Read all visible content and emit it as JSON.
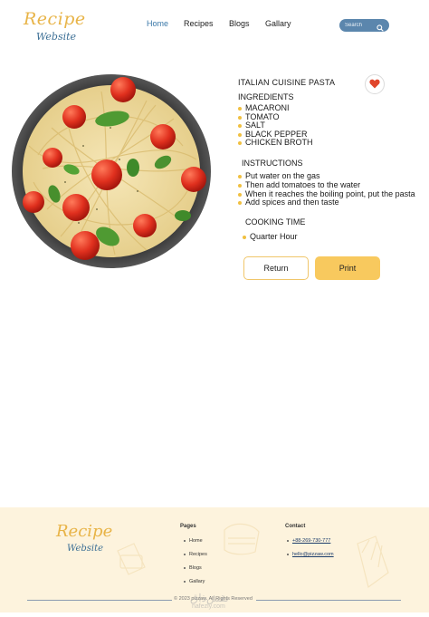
{
  "header": {
    "logo_line1": "Recipe",
    "logo_line2": "Website",
    "nav": [
      {
        "label": "Home",
        "active": true
      },
      {
        "label": "Recipes"
      },
      {
        "label": "Blogs"
      },
      {
        "label": "Gallary"
      }
    ],
    "search_placeholder": "Search"
  },
  "recipe": {
    "title": "ITALIAN CUISINE PASTA",
    "ingredients_heading": "INGREDIENTS",
    "ingredients": [
      "MACARONI",
      "TOMATO",
      "SALT",
      "BLACK PEPPER",
      "CHICKEN BROTH"
    ],
    "instructions_heading": "INSTRUCTIONS",
    "instructions": [
      "Put water on the gas",
      "Then add tomatoes to the water",
      "When it reaches the boiling point, put the pasta",
      "Add spices and then taste"
    ],
    "cooking_time_heading": "COOKING TIME",
    "cooking_time": "Quarter Hour",
    "buttons": {
      "return": "Return",
      "print": "Print"
    }
  },
  "footer": {
    "logo_line1": "Recipe",
    "logo_line2": "Website",
    "pages_heading": "Pages",
    "pages": [
      "Home",
      "Recipes",
      "Blogs",
      "Gallary"
    ],
    "contact_heading": "Contact",
    "phone": "+88-269-730-777",
    "email": "hello@pizzaw.com",
    "copyright": "© 2023 pizzaw. All Rights Reserved",
    "watermark": "نقش‌ذاق",
    "watermark_sub": "nafezly.com"
  },
  "colors": {
    "accent": "#f8c95e",
    "nav_active": "#3a78a8",
    "search_bg": "#5b86ad",
    "footer_bg": "#fdf3dd",
    "heart": "#e0452b"
  }
}
